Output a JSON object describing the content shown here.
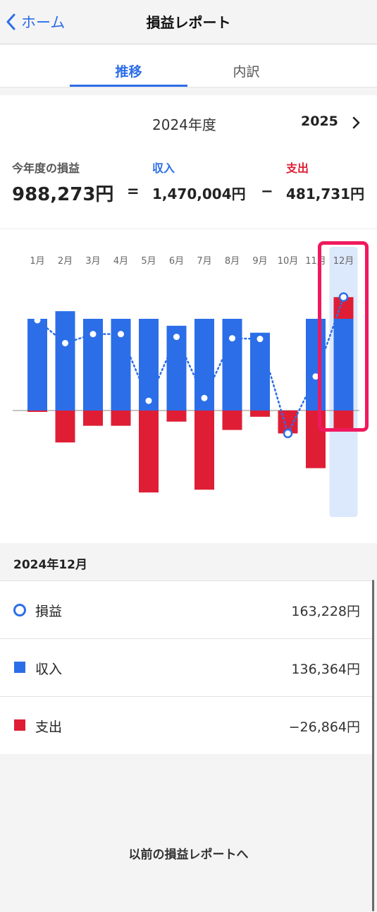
{
  "nav": {
    "back_label": "ホーム",
    "title": "損益レポート"
  },
  "tabs": [
    {
      "label": "推移",
      "active": true
    },
    {
      "label": "内訳",
      "active": false
    }
  ],
  "year": {
    "current": "2024年度",
    "next": "2025"
  },
  "summary": {
    "profit_label": "今年度の損益",
    "profit_value": "988,273円",
    "eq": "=",
    "income_label": "収入",
    "income_value": "1,470,004円",
    "minus": "−",
    "expense_label": "支出",
    "expense_value": "481,731円"
  },
  "colors": {
    "income": "#2c6ee8",
    "expense": "#df1e35",
    "highlight": "#f0195e",
    "accent": "#2c6ee8"
  },
  "chart_data": {
    "type": "bar",
    "categories": [
      "1月",
      "2月",
      "3月",
      "4月",
      "5月",
      "6月",
      "7月",
      "8月",
      "9月",
      "10月",
      "11月",
      "12月"
    ],
    "series": [
      {
        "name": "収入",
        "values": [
          132000,
          143000,
          132000,
          132000,
          132000,
          122000,
          132000,
          132000,
          112000,
          0,
          132000,
          132000
        ]
      },
      {
        "name": "支出",
        "values": [
          -2000,
          -46000,
          -22000,
          -22000,
          -118000,
          -16000,
          -114000,
          -28000,
          -9000,
          -33000,
          -83000,
          -26864
        ]
      },
      {
        "name": "損益",
        "values": [
          130000,
          97000,
          110000,
          110000,
          14000,
          106000,
          18000,
          104000,
          103000,
          -33000,
          49000,
          163228
        ]
      }
    ],
    "selected_index": 11
  },
  "detail": {
    "title": "2024年12月",
    "rows": [
      {
        "label": "損益",
        "value": "163,228円"
      },
      {
        "label": "収入",
        "value": "136,364円"
      },
      {
        "label": "支出",
        "value": "−26,864円"
      }
    ]
  },
  "footer": {
    "link_label": "以前の損益レポートへ"
  }
}
